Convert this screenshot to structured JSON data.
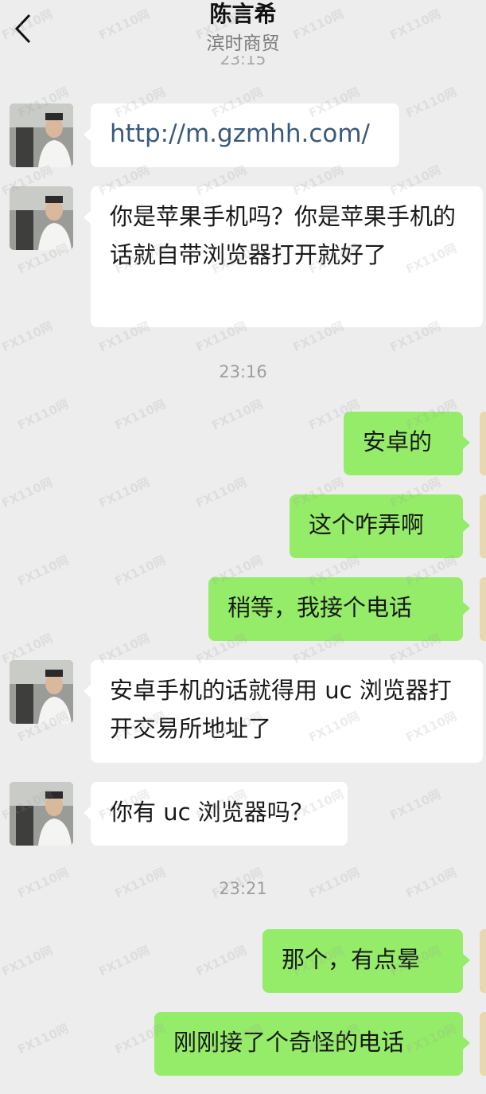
{
  "header": {
    "title": "陈言希",
    "subtitle": "滨时商贸",
    "cut_time": "23:15"
  },
  "messages": [
    {
      "side": "in",
      "text": "http://m.gzmhh.com/"
    },
    {
      "side": "in",
      "text": "你是苹果手机吗？你是苹果手机的话就自带浏览器打开就好了"
    },
    {
      "time": "23:16"
    },
    {
      "side": "out",
      "text": "安卓的"
    },
    {
      "side": "out",
      "text": "这个咋弄啊"
    },
    {
      "side": "out",
      "text": "稍等，我接个电话"
    },
    {
      "side": "in",
      "text": "安卓手机的话就得用 uc 浏览器打开交易所地址了"
    },
    {
      "side": "in",
      "text": "你有 uc 浏览器吗？"
    },
    {
      "time": "23:21"
    },
    {
      "side": "out",
      "text": "那个，有点晕"
    },
    {
      "side": "out",
      "text": "刚刚接了个奇怪的电话"
    }
  ],
  "watermark": "FX110网"
}
